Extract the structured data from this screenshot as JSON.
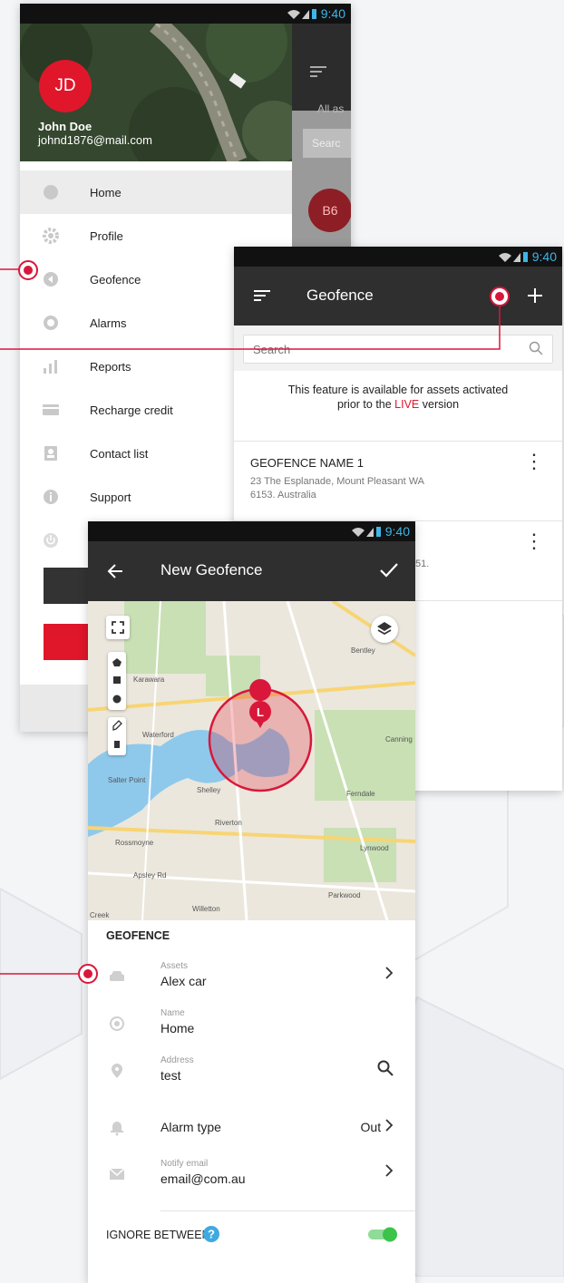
{
  "status_bar": {
    "time": "9:40"
  },
  "drawer": {
    "avatar_initials": "JD",
    "user_name": "John Doe",
    "user_email": "johnd1876@mail.com",
    "background_badge": "B6",
    "background_label": "All as",
    "background_search": "Searc",
    "items": [
      {
        "label": "Home",
        "icon": "home-icon"
      },
      {
        "label": "Profile",
        "icon": "gear-icon"
      },
      {
        "label": "Geofence",
        "icon": "geofence-icon"
      },
      {
        "label": "Alarms",
        "icon": "alarm-icon"
      },
      {
        "label": "Reports",
        "icon": "bar-chart-icon"
      },
      {
        "label": "Recharge credit",
        "icon": "credit-card-icon"
      },
      {
        "label": "Contact list",
        "icon": "contact-icon"
      },
      {
        "label": "Support",
        "icon": "info-icon"
      }
    ]
  },
  "geofence_list": {
    "title": "Geofence",
    "search_placeholder": "Search",
    "info_line1": "This feature is available for assets activated",
    "info_line2_before": "prior to the ",
    "info_live": "LIVE",
    "info_line2_after": " version",
    "items": [
      {
        "name": "GEOFENCE NAME 1",
        "address_line1": "23 The Esplanade, Mount Pleasant WA",
        "address_line2": "6153. Australia"
      },
      {
        "name": "",
        "address_line1": "51.",
        "address_line2": ""
      }
    ]
  },
  "new_geofence": {
    "title": "New Geofence",
    "section_title": "GEOFENCE",
    "map_marker_letter": "L",
    "map_labels": [
      "Karawara",
      "Waterford",
      "Salter Point",
      "Shelley",
      "Riverton",
      "Rossmoyne",
      "Bentley",
      "Canning",
      "Ferndale",
      "Lynwood",
      "Parkwood",
      "Willetton",
      "Creek",
      "Apsley Rd"
    ],
    "fields": {
      "assets_label": "Assets",
      "assets_value": "Alex car",
      "name_label": "Name",
      "name_value": "Home",
      "address_label": "Address",
      "address_value": "test",
      "alarm_type_label": "Alarm type",
      "alarm_type_value": "Out",
      "notify_label": "Notify email",
      "notify_value": "email@com.au",
      "ignore_between_label": "IGNORE BETWEEN"
    }
  },
  "colors": {
    "accent_red": "#e0162b",
    "status_blue": "#3fb5e8",
    "toggle_green": "#3cc34a",
    "appbar": "#2f2f2f"
  }
}
